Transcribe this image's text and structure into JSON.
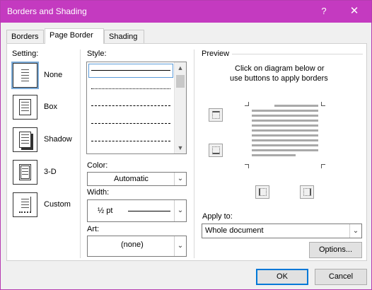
{
  "window": {
    "title": "Borders and Shading",
    "help_glyph": "?",
    "close_glyph": "✕"
  },
  "tabs": [
    {
      "label": "Borders",
      "active": false
    },
    {
      "label": "Page Border",
      "active": true
    },
    {
      "label": "Shading",
      "active": false
    }
  ],
  "setting": {
    "header": "Setting:",
    "items": [
      {
        "label": "None",
        "selected": true
      },
      {
        "label": "Box",
        "selected": false
      },
      {
        "label": "Shadow",
        "selected": false
      },
      {
        "label": "3-D",
        "selected": false
      },
      {
        "label": "Custom",
        "selected": false
      }
    ]
  },
  "style": {
    "header": "Style:",
    "options": [
      "solid",
      "dotted",
      "dashed-small",
      "dashed",
      "dash-dot"
    ]
  },
  "color": {
    "label": "Color:",
    "value": "Automatic"
  },
  "width": {
    "label": "Width:",
    "value": "½ pt"
  },
  "art": {
    "label": "Art:",
    "value": "(none)"
  },
  "preview": {
    "header": "Preview",
    "instructions_line1": "Click on diagram below or",
    "instructions_line2": "use buttons to apply borders"
  },
  "apply_to": {
    "label": "Apply to:",
    "value": "Whole document"
  },
  "buttons": {
    "options": "Options...",
    "ok": "OK",
    "cancel": "Cancel"
  },
  "colors": {
    "titlebar": "#c43ac0",
    "accent": "#0078d7"
  }
}
